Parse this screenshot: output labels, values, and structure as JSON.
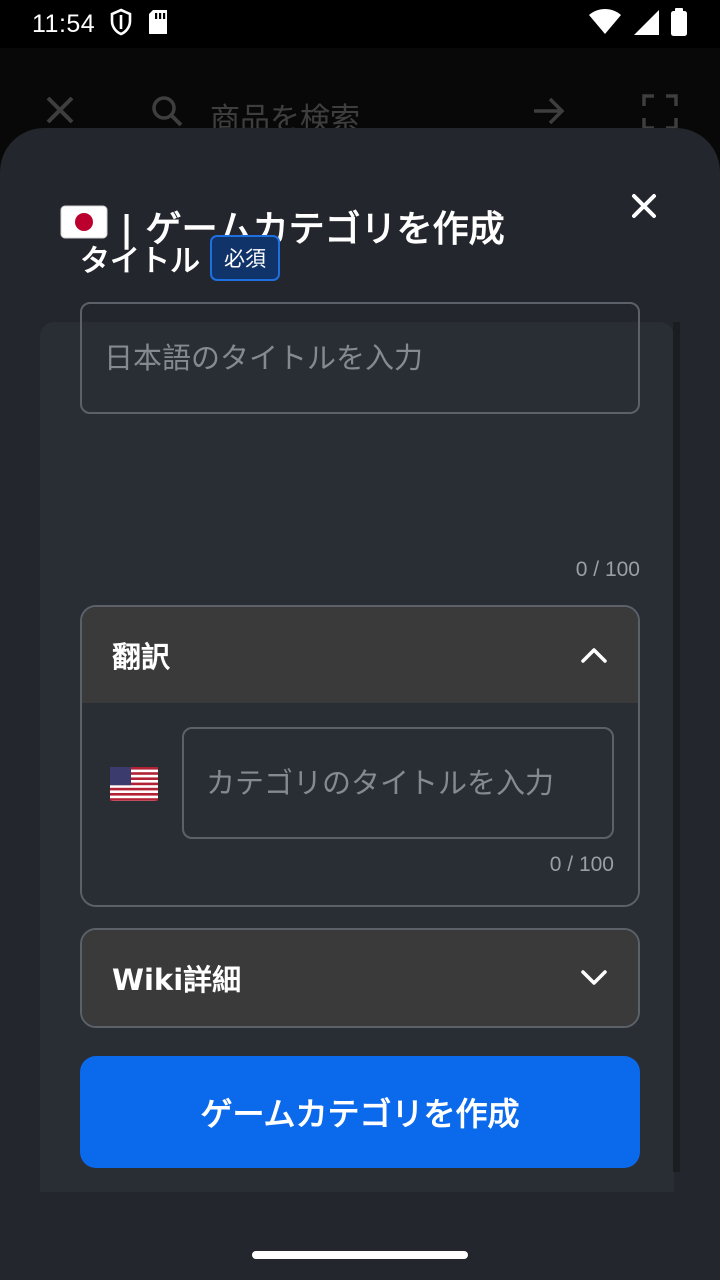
{
  "status_bar": {
    "time": "11:54",
    "icons": [
      "shield-icon",
      "sd-card-icon",
      "wifi-icon",
      "signal-icon",
      "battery-icon"
    ]
  },
  "background_app": {
    "search_placeholder": "商品を検索",
    "icons": [
      "close-icon",
      "search-icon",
      "arrow-right-icon",
      "scan-icon"
    ]
  },
  "sheet": {
    "flag": "🇯🇵",
    "title": "| ゲームカテゴリを作成",
    "close_icon": "close-icon"
  },
  "title_field": {
    "label": "タイトル",
    "required_badge": "必須",
    "placeholder": "日本語のタイトルを入力",
    "value": "",
    "counter": "0 / 100"
  },
  "translation_section": {
    "title": "翻訳",
    "expanded": true,
    "flag": "🇺🇸",
    "placeholder": "カテゴリのタイトルを入力",
    "value": "",
    "counter": "0 / 100"
  },
  "wiki_section": {
    "title": "Wiki詳細",
    "expanded": false
  },
  "submit_button": {
    "label": "ゲームカテゴリを作成"
  },
  "colors": {
    "sheet_bg": "#23262c",
    "card_bg": "#292d34",
    "accordion_header_bg": "#3a3a3a",
    "primary": "#0b69eb",
    "badge_border": "#1e6fe0",
    "badge_bg": "#10346a",
    "input_border": "#5c6068",
    "placeholder": "#858990"
  }
}
